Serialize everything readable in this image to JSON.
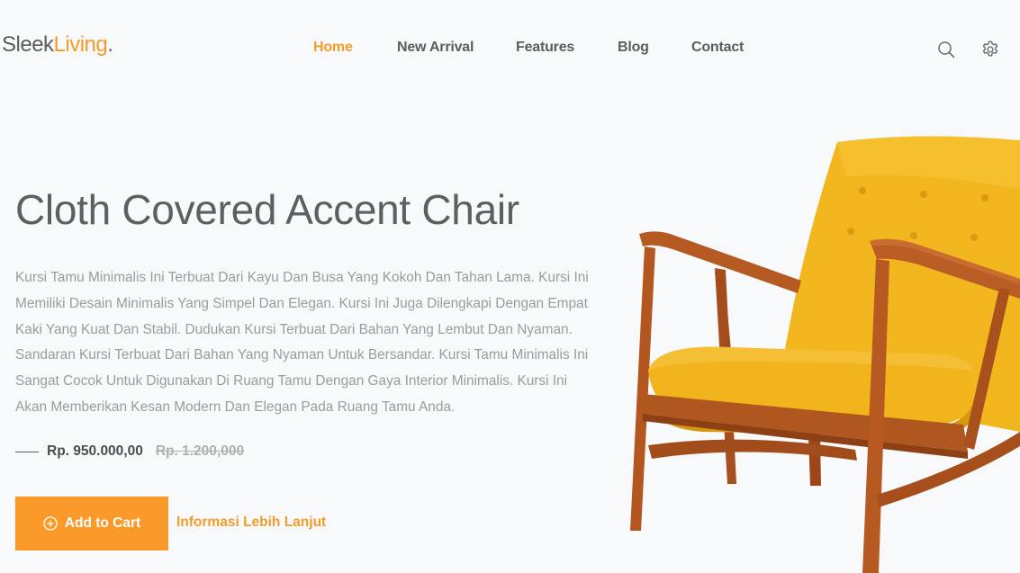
{
  "brand": {
    "name_part1": "Sleek",
    "name_part2": "Living",
    "name_dot": ".",
    "accent_color": "#f39c2a"
  },
  "nav": {
    "items": [
      {
        "label": "Home",
        "active": true
      },
      {
        "label": "New Arrival",
        "active": false
      },
      {
        "label": "Features",
        "active": false
      },
      {
        "label": "Blog",
        "active": false
      },
      {
        "label": "Contact",
        "active": false
      }
    ],
    "search_icon": "search-icon",
    "settings_icon": "gear-icon"
  },
  "hero": {
    "title": "Cloth Covered Accent Chair",
    "description": "Kursi Tamu Minimalis Ini Terbuat Dari Kayu Dan Busa Yang Kokoh Dan Tahan Lama. Kursi Ini Memiliki Desain Minimalis Yang Simpel Dan Elegan. Kursi Ini Juga Dilengkapi Dengan Empat Kaki Yang Kuat Dan Stabil. Dudukan Kursi Terbuat Dari Bahan Yang Lembut Dan Nyaman. Sandaran Kursi Terbuat Dari Bahan Yang Nyaman Untuk Bersandar. Kursi Tamu Minimalis Ini Sangat Cocok Untuk Digunakan Di Ruang Tamu Dengan Gaya Interior Minimalis. Kursi Ini Akan Memberikan Kesan Modern Dan Elegan Pada Ruang Tamu Anda.",
    "price": "Rp. 950.000,00",
    "old_price": "Rp. 1.200,000",
    "add_to_cart_label": "Add to Cart",
    "add_to_cart_icon": "plus-circle-icon",
    "more_info_label": "Informasi Lebih Lanjut",
    "button_color": "#f99a2a",
    "product_image": "yellow-accent-chair"
  }
}
